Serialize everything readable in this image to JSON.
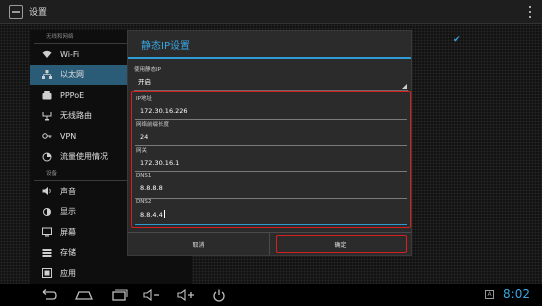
{
  "topbar": {
    "title": "设置"
  },
  "sidebar": {
    "section_wireless": "无线和网络",
    "items_top": [
      {
        "label": "Wi-Fi",
        "icon": "wifi-icon"
      },
      {
        "label": "以太网",
        "icon": "ethernet-icon"
      },
      {
        "label": "PPPoE",
        "icon": "phone-icon"
      },
      {
        "label": "无线路由",
        "icon": "antenna-icon"
      },
      {
        "label": "VPN",
        "icon": "key-icon"
      },
      {
        "label": "流量使用情况",
        "icon": "pie-icon"
      }
    ],
    "section_device": "设备",
    "items_device": [
      {
        "label": "声音",
        "icon": "speaker-icon"
      },
      {
        "label": "显示",
        "icon": "brightness-icon"
      },
      {
        "label": "屏幕",
        "icon": "screen-icon"
      },
      {
        "label": "存储",
        "icon": "storage-icon"
      },
      {
        "label": "应用",
        "icon": "apps-icon"
      }
    ]
  },
  "dialog": {
    "title": "静态IP设置",
    "use_static": {
      "label": "使用静态IP",
      "value": "开启"
    },
    "fields": [
      {
        "label": "IP地址",
        "value": "172.30.16.226"
      },
      {
        "label": "网络前缀长度",
        "value": "24"
      },
      {
        "label": "网关",
        "value": "172.30.16.1"
      },
      {
        "label": "DNS1",
        "value": "8.8.8.8"
      },
      {
        "label": "DNS2",
        "value": "8.8.4.4"
      }
    ],
    "cancel_label": "取消",
    "ok_label": "确定"
  },
  "statusbar": {
    "time": "8:02",
    "badge": "A"
  },
  "colors": {
    "accent": "#39a6e3",
    "highlight": "#d62020",
    "selected": "#2a5b77"
  }
}
